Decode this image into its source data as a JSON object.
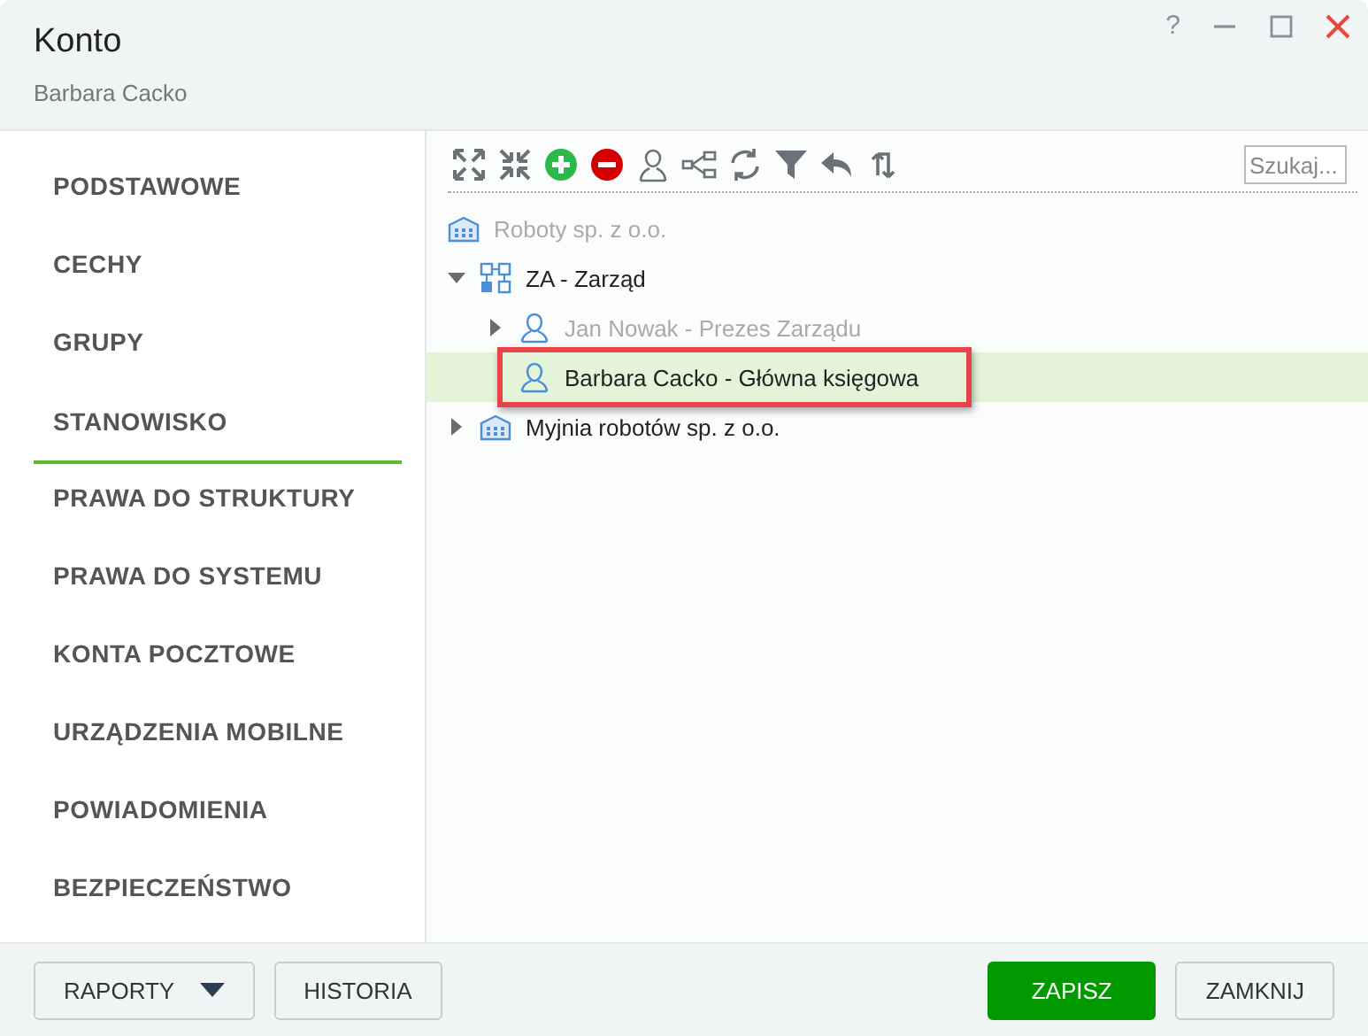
{
  "window": {
    "title": "Konto",
    "subtitle": "Barbara Cacko",
    "controls": [
      "?"
    ]
  },
  "sidebar": {
    "items": [
      {
        "label": "PODSTAWOWE",
        "selected": false
      },
      {
        "label": "CECHY",
        "selected": false
      },
      {
        "label": "GRUPY",
        "selected": false
      },
      {
        "label": "STANOWISKO",
        "selected": true
      },
      {
        "label": "PRAWA DO STRUKTURY",
        "selected": false
      },
      {
        "label": "PRAWA DO SYSTEMU",
        "selected": false
      },
      {
        "label": "KONTA POCZTOWE",
        "selected": false
      },
      {
        "label": "URZĄDZENIA MOBILNE",
        "selected": false
      },
      {
        "label": "POWIADOMIENIA",
        "selected": false
      },
      {
        "label": "BEZPIECZEŃSTWO",
        "selected": false
      }
    ]
  },
  "toolbar": {
    "search": {
      "placeholder": "Szukaj..."
    }
  },
  "tree": [
    {
      "kind": "company",
      "label": "Roboty sp. z o.o.",
      "expandable": false,
      "expanded": false,
      "dimmed": true,
      "selected": false
    },
    {
      "kind": "unit",
      "label": "ZA - Zarząd",
      "expandable": true,
      "expanded": true,
      "dimmed": false,
      "selected": false,
      "children": [
        {
          "kind": "person",
          "label": "Jan Nowak - Prezes Zarządu",
          "expandable": true,
          "expanded": false,
          "dimmed": true,
          "selected": false
        },
        {
          "kind": "person",
          "label": "Barbara Cacko - Główna księgowa",
          "expandable": false,
          "expanded": false,
          "dimmed": false,
          "selected": true
        }
      ]
    },
    {
      "kind": "company",
      "label": "Myjnia robotów sp. z o.o.",
      "expandable": true,
      "expanded": false,
      "dimmed": false,
      "selected": false
    }
  ],
  "footer": {
    "left": [
      {
        "label": "RAPORTY",
        "kind": "dropdown"
      },
      {
        "label": "HISTORIA",
        "kind": "plain"
      }
    ],
    "right": [
      {
        "label": "ZAPISZ",
        "kind": "primary"
      },
      {
        "label": "ZAMKNIJ",
        "kind": "plain"
      }
    ]
  }
}
